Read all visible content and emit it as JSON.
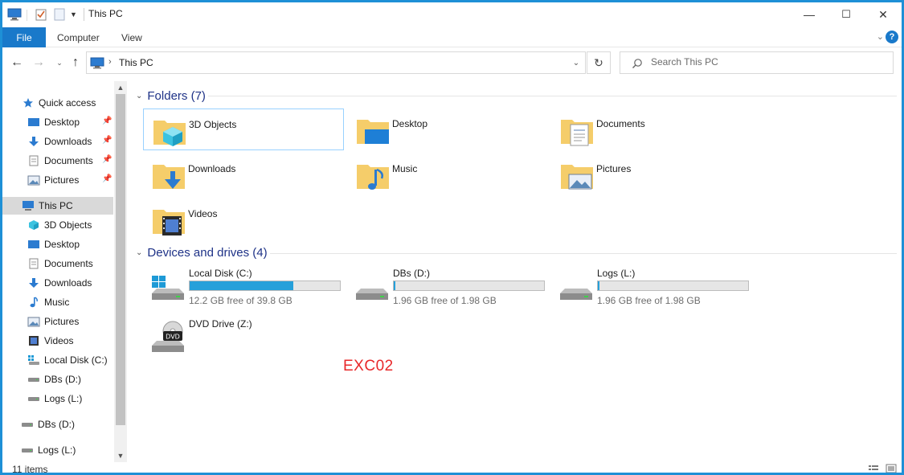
{
  "window": {
    "title": "This PC",
    "controls": {
      "minimize": "—",
      "maximize": "☐",
      "close": "✕"
    }
  },
  "ribbon": {
    "tabs": [
      "File",
      "Computer",
      "View"
    ],
    "help": "?"
  },
  "address": {
    "crumb": "This PC",
    "search_placeholder": "Search This PC"
  },
  "nav": {
    "quick_access": "Quick access",
    "quick_items": [
      "Desktop",
      "Downloads",
      "Documents",
      "Pictures"
    ],
    "this_pc": "This PC",
    "pc_items": [
      "3D Objects",
      "Desktop",
      "Documents",
      "Downloads",
      "Music",
      "Pictures",
      "Videos",
      "Local Disk (C:)",
      "DBs (D:)",
      "Logs (L:)"
    ],
    "extra_items": [
      "DBs (D:)",
      "Logs (L:)"
    ]
  },
  "folders": {
    "header": "Folders (7)",
    "items": [
      "3D Objects",
      "Desktop",
      "Documents",
      "Downloads",
      "Music",
      "Pictures",
      "Videos"
    ]
  },
  "drives": {
    "header": "Devices and drives (4)",
    "items": [
      {
        "name": "Local Disk (C:)",
        "free": "12.2 GB free of 39.8 GB",
        "used_fraction": 0.69
      },
      {
        "name": "DBs (D:)",
        "free": "1.96 GB free of 1.98 GB",
        "used_fraction": 0.01
      },
      {
        "name": "Logs (L:)",
        "free": "1.96 GB free of 1.98 GB",
        "used_fraction": 0.01
      },
      {
        "name": "DVD Drive (Z:)",
        "label": "DVD"
      }
    ]
  },
  "watermark": "EXC02",
  "status": {
    "count": "11 items"
  },
  "colors": {
    "accent": "#1979ca",
    "group_header": "#1e3287",
    "bar_fill": "#26a0da",
    "watermark": "#e8282a"
  }
}
